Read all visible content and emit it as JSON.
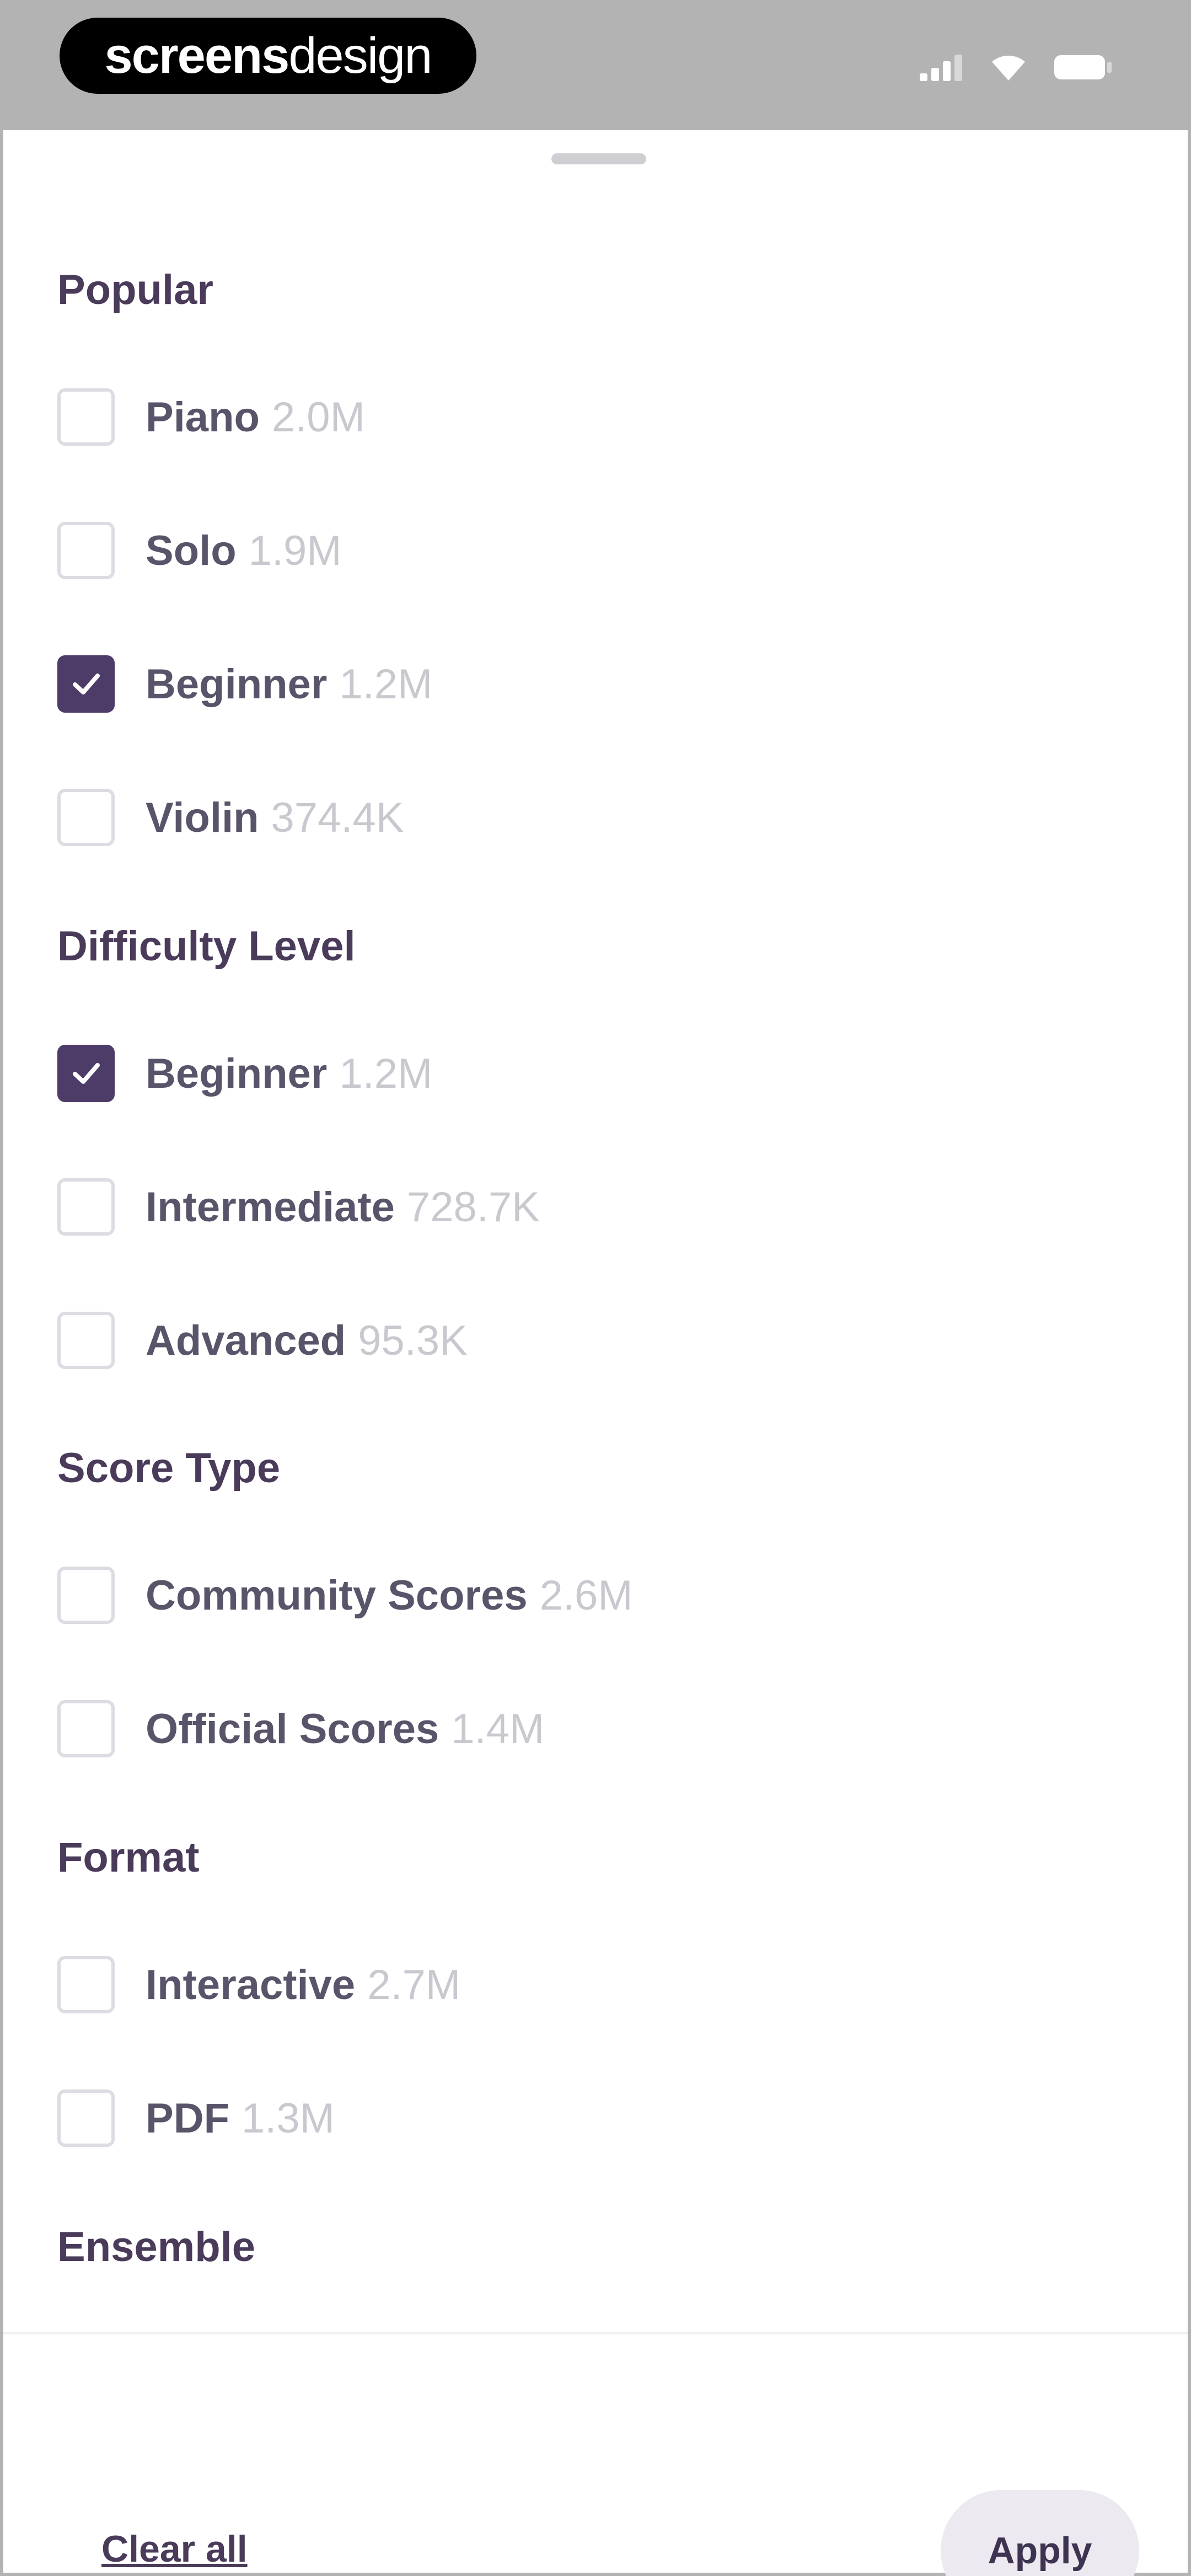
{
  "status_bar": {
    "brand_left": "screens",
    "brand_right": "design",
    "icons": [
      "signal-icon",
      "wifi-icon",
      "battery-icon"
    ]
  },
  "sections": [
    {
      "title": "Popular",
      "options": [
        {
          "label": "Piano",
          "count": "2.0M",
          "checked": false
        },
        {
          "label": "Solo",
          "count": "1.9M",
          "checked": false
        },
        {
          "label": "Beginner",
          "count": "1.2M",
          "checked": true
        },
        {
          "label": "Violin",
          "count": "374.4K",
          "checked": false
        }
      ]
    },
    {
      "title": "Difficulty Level",
      "options": [
        {
          "label": "Beginner",
          "count": "1.2M",
          "checked": true
        },
        {
          "label": "Intermediate",
          "count": "728.7K",
          "checked": false
        },
        {
          "label": "Advanced",
          "count": "95.3K",
          "checked": false
        }
      ]
    },
    {
      "title": "Score Type",
      "options": [
        {
          "label": "Community Scores",
          "count": "2.6M",
          "checked": false
        },
        {
          "label": "Official Scores",
          "count": "1.4M",
          "checked": false
        }
      ]
    },
    {
      "title": "Format",
      "options": [
        {
          "label": "Interactive",
          "count": "2.7M",
          "checked": false
        },
        {
          "label": "PDF",
          "count": "1.3M",
          "checked": false
        }
      ]
    },
    {
      "title": "Ensemble",
      "options": []
    }
  ],
  "footer": {
    "clear_label": "Clear all",
    "apply_label": "Apply"
  },
  "colors": {
    "accent": "#4e3c68",
    "heading": "#4a3b5a",
    "count": "#c8c8cf"
  }
}
